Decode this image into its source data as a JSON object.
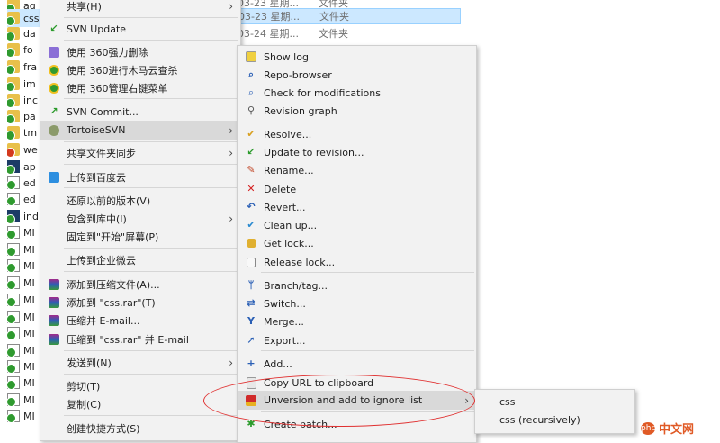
{
  "file_list": [
    {
      "name": "aq",
      "type": "folder"
    },
    {
      "name": "css",
      "type": "folder",
      "selected": true
    },
    {
      "name": "da",
      "type": "folder"
    },
    {
      "name": "fo",
      "type": "folder"
    },
    {
      "name": "fra",
      "type": "folder"
    },
    {
      "name": "im",
      "type": "folder"
    },
    {
      "name": "inc",
      "type": "folder"
    },
    {
      "name": "pa",
      "type": "folder"
    },
    {
      "name": "tm",
      "type": "folder"
    },
    {
      "name": "we",
      "type": "folder-error"
    },
    {
      "name": "ap",
      "type": "ps"
    },
    {
      "name": "ed",
      "type": "doc"
    },
    {
      "name": "ed",
      "type": "doc"
    },
    {
      "name": "ind",
      "type": "ps"
    },
    {
      "name": "MI",
      "type": "doc"
    },
    {
      "name": "MI",
      "type": "doc"
    },
    {
      "name": "MI",
      "type": "doc"
    },
    {
      "name": "MI",
      "type": "doc"
    },
    {
      "name": "MI",
      "type": "doc"
    },
    {
      "name": "MI",
      "type": "doc"
    },
    {
      "name": "MI",
      "type": "doc"
    },
    {
      "name": "MI",
      "type": "doc"
    },
    {
      "name": "MI",
      "type": "doc"
    },
    {
      "name": "MI",
      "type": "doc"
    },
    {
      "name": "MI",
      "type": "doc"
    },
    {
      "name": "MI",
      "type": "doc"
    }
  ],
  "background_rows": [
    {
      "date": "03-23 星期...",
      "kind": "文件夹"
    },
    {
      "date": "03-23 星期...",
      "kind": "文件夹",
      "selected": true
    },
    {
      "date": "03-24 星期...",
      "kind": "文件夹"
    }
  ],
  "main_menu": {
    "items": [
      {
        "label": "共享(H)",
        "icon": "none",
        "submenu": true
      },
      {
        "label": "SVN Update",
        "icon": "svn-update-icon"
      },
      {
        "label": "使用 360强力删除",
        "icon": "360-delete-icon"
      },
      {
        "label": "使用 360进行木马云查杀",
        "icon": "360-scan-icon"
      },
      {
        "label": "使用 360管理右键菜单",
        "icon": "360-menu-icon"
      },
      {
        "label": "SVN Commit...",
        "icon": "svn-commit-icon"
      },
      {
        "label": "TortoiseSVN",
        "icon": "tortoise-icon",
        "submenu": true
      },
      {
        "label": "共享文件夹同步",
        "icon": "none",
        "submenu": true
      },
      {
        "label": "上传到百度云",
        "icon": "baidu-cloud-icon"
      },
      {
        "label": "还原以前的版本(V)",
        "icon": "none"
      },
      {
        "label": "包含到库中(I)",
        "icon": "none",
        "submenu": true
      },
      {
        "label": "固定到\"开始\"屏幕(P)",
        "icon": "none"
      },
      {
        "label": "上传到企业微云",
        "icon": "none"
      },
      {
        "label": "添加到压缩文件(A)...",
        "icon": "winrar-icon"
      },
      {
        "label": "添加到 \"css.rar\"(T)",
        "icon": "winrar-icon"
      },
      {
        "label": "压缩并 E-mail...",
        "icon": "winrar-icon"
      },
      {
        "label": "压缩到 \"css.rar\" 并 E-mail",
        "icon": "winrar-icon"
      },
      {
        "label": "发送到(N)",
        "icon": "none",
        "submenu": true
      },
      {
        "label": "剪切(T)",
        "icon": "none"
      },
      {
        "label": "复制(C)",
        "icon": "none"
      },
      {
        "label": "创建快捷方式(S)",
        "icon": "none"
      }
    ]
  },
  "svn_menu": {
    "items": [
      {
        "label": "Show log",
        "icon": "show-log-icon"
      },
      {
        "label": "Repo-browser",
        "icon": "repo-browser-icon"
      },
      {
        "label": "Check for modifications",
        "icon": "check-modifications-icon"
      },
      {
        "label": "Revision graph",
        "icon": "revision-graph-icon"
      },
      {
        "label": "Resolve...",
        "icon": "resolve-icon"
      },
      {
        "label": "Update to revision...",
        "icon": "update-revision-icon"
      },
      {
        "label": "Rename...",
        "icon": "rename-icon"
      },
      {
        "label": "Delete",
        "icon": "delete-icon"
      },
      {
        "label": "Revert...",
        "icon": "revert-icon"
      },
      {
        "label": "Clean up...",
        "icon": "cleanup-icon"
      },
      {
        "label": "Get lock...",
        "icon": "lock-icon"
      },
      {
        "label": "Release lock...",
        "icon": "unlock-icon"
      },
      {
        "label": "Branch/tag...",
        "icon": "branch-icon"
      },
      {
        "label": "Switch...",
        "icon": "switch-icon"
      },
      {
        "label": "Merge...",
        "icon": "merge-icon"
      },
      {
        "label": "Export...",
        "icon": "export-icon"
      },
      {
        "label": "Add...",
        "icon": "add-icon"
      },
      {
        "label": "Copy URL to clipboard",
        "icon": "copy-url-icon"
      },
      {
        "label": "Unversion and add to ignore list",
        "icon": "ignore-icon",
        "submenu": true
      },
      {
        "label": "Create patch...",
        "icon": "patch-icon"
      }
    ]
  },
  "ignore_menu": {
    "items": [
      {
        "label": "css"
      },
      {
        "label": "css (recursively)"
      }
    ]
  },
  "watermark": {
    "badge": "php",
    "text": "中文网"
  },
  "colors": {
    "menu_bg": "#f2f2f2",
    "highlight": "#d9d9d9",
    "selection": "#cce8ff",
    "annotation_ring": "#e03030"
  }
}
